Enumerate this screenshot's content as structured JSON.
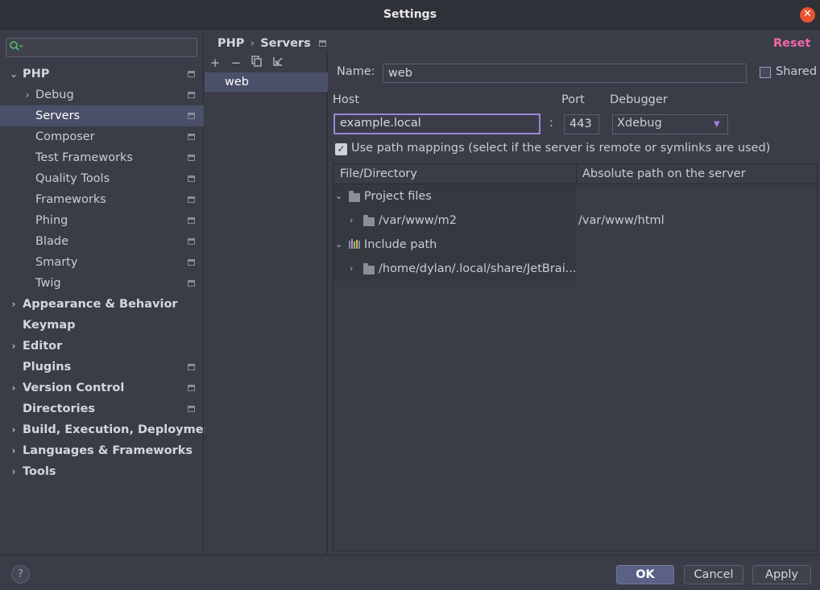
{
  "window": {
    "title": "Settings"
  },
  "sidebar": {
    "search": {
      "value": "",
      "placeholder": ""
    },
    "items": [
      {
        "label": "PHP",
        "expanded": true,
        "selected": false
      },
      {
        "label": "Debug",
        "expanded": false,
        "selected": false
      },
      {
        "label": "Servers",
        "selected": true
      },
      {
        "label": "Composer",
        "selected": false
      },
      {
        "label": "Test Frameworks",
        "selected": false
      },
      {
        "label": "Quality Tools",
        "selected": false
      },
      {
        "label": "Frameworks",
        "selected": false
      },
      {
        "label": "Phing",
        "selected": false
      },
      {
        "label": "Blade",
        "selected": false
      },
      {
        "label": "Smarty",
        "selected": false
      },
      {
        "label": "Twig",
        "selected": false
      },
      {
        "label": "Appearance & Behavior",
        "expanded": false
      },
      {
        "label": "Keymap"
      },
      {
        "label": "Editor",
        "expanded": false
      },
      {
        "label": "Plugins"
      },
      {
        "label": "Version Control",
        "expanded": false
      },
      {
        "label": "Directories"
      },
      {
        "label": "Build, Execution, Deployment",
        "expanded": false
      },
      {
        "label": "Languages & Frameworks",
        "expanded": false
      },
      {
        "label": "Tools",
        "expanded": false
      }
    ]
  },
  "breadcrumb": {
    "parent": "PHP",
    "separator": "›",
    "current": "Servers"
  },
  "reset_label": "Reset",
  "servers": {
    "items": [
      "web"
    ],
    "selected": "web"
  },
  "form": {
    "name_label": "Name:",
    "name_value": "web",
    "shared_label": "Shared",
    "shared_checked": false,
    "host_label": "Host",
    "host_value": "example.local",
    "colon": ":",
    "port_label": "Port",
    "port_value": "443",
    "debugger_label": "Debugger",
    "debugger_value": "Xdebug",
    "use_mappings_label": "Use path mappings (select if the server is remote or symlinks are used)",
    "use_mappings_checked": true
  },
  "mappings": {
    "columns": [
      "File/Directory",
      "Absolute path on the server"
    ],
    "groups": [
      {
        "label": "Project files",
        "rows": [
          {
            "local": "/var/www/m2",
            "remote": "/var/www/html"
          }
        ]
      },
      {
        "label": "Include path",
        "rows": [
          {
            "local": "/home/dylan/.local/share/JetBrai...",
            "remote": ""
          }
        ]
      }
    ]
  },
  "buttons": {
    "help": "?",
    "ok": "OK",
    "cancel": "Cancel",
    "apply": "Apply"
  },
  "colors": {
    "accent": "#9b86d6",
    "reset": "#f06aa6",
    "selection": "#4a5068",
    "close": "#e8542f"
  }
}
